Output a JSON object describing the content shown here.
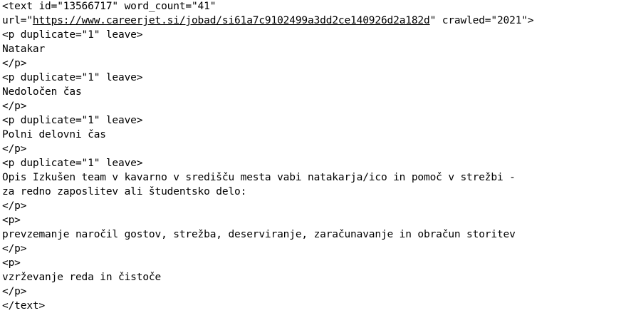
{
  "document": {
    "line1": "<text id=\"13566717\" word_count=\"41\"",
    "line2_prefix": "url=\"",
    "line2_url": "https://www.careerjet.si/jobad/si61a7c9102499a3dd2ce140926d2a182d",
    "line2_suffix": "\" crawled=\"2021\">",
    "line3": "<p duplicate=\"1\" leave>",
    "line4": "Natakar",
    "line5": "</p>",
    "line6": "<p duplicate=\"1\" leave>",
    "line7": "Nedoločen čas",
    "line8": "</p>",
    "line9": "<p duplicate=\"1\" leave>",
    "line10": "Polni delovni čas",
    "line11": "</p>",
    "line12": "<p duplicate=\"1\" leave>",
    "line13": "Opis Izkušen team v kavarno v središču mesta vabi natakarja/ico in pomoč v strežbi -",
    "line14": "za redno zaposlitev ali študentsko delo:",
    "line15": "</p>",
    "line16": "<p>",
    "line17": "prevzemanje naročil gostov, strežba, deserviranje, zaračunavanje in obračun storitev",
    "line18": "</p>",
    "line19": "<p>",
    "line20": "vzrževanje reda in čistoče",
    "line21": "</p>",
    "line22": "</text>"
  }
}
